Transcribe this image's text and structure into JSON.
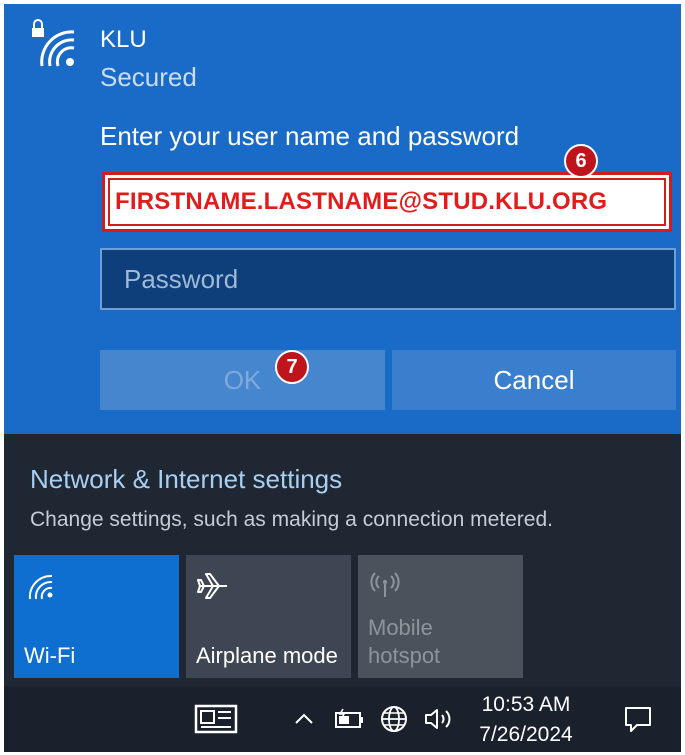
{
  "wifi_prompt": {
    "network_name": "KLU",
    "status": "Secured",
    "prompt": "Enter your user name and password",
    "username_value": "FIRSTNAME.LASTNAME@STUD.KLU.ORG",
    "password_placeholder": "Password",
    "ok_label": "OK",
    "cancel_label": "Cancel"
  },
  "annotations": {
    "step_username": "6",
    "step_ok": "7",
    "color": "#c0141d"
  },
  "network_panel": {
    "settings_link": "Network & Internet settings",
    "settings_description": "Change settings, such as making a connection metered.",
    "quick_actions": [
      {
        "label": "Wi-Fi",
        "icon": "wifi-icon",
        "active": true
      },
      {
        "label": "Airplane mode",
        "icon": "airplane-icon",
        "active": false
      },
      {
        "label_line1": "Mobile",
        "label_line2": "hotspot",
        "icon": "hotspot-icon",
        "disabled": true
      }
    ]
  },
  "taskbar": {
    "time": "10:53 AM",
    "date": "7/26/2024",
    "icons": [
      "news-icon",
      "chevron-up-icon",
      "battery-icon",
      "globe-icon",
      "volume-icon",
      "notification-icon"
    ]
  },
  "colors": {
    "panel_blue": "#1a6bc7",
    "accent_blue": "#0f6fd1",
    "dark_panel": "#1f2733",
    "link_blue": "#a8cff2"
  }
}
